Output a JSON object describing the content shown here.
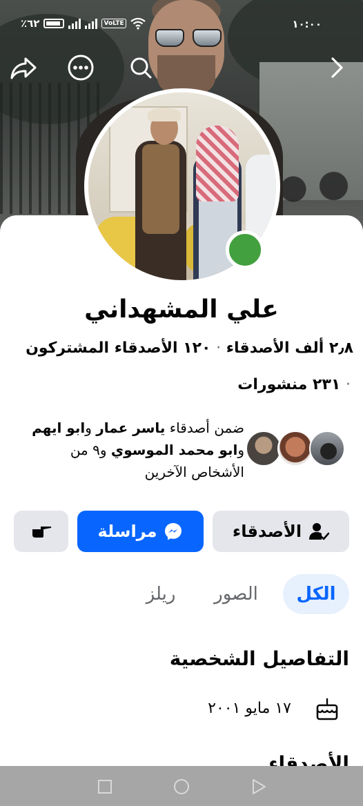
{
  "status_bar": {
    "time": "١٠:٠٠",
    "battery": "٪٦٢",
    "volte": "VoLTE"
  },
  "top_nav": {
    "icons": [
      "share-icon",
      "more-icon",
      "search-icon",
      "chevron-right-icon"
    ]
  },
  "profile": {
    "name": "علي المشهداني",
    "friends_count": "٢٫٨ ألف الأصدقاء",
    "mutual_friends": "١٢٠ الأصدقاء المشتركون",
    "posts": "٢٣١ منشورات",
    "separator": "·",
    "online": true
  },
  "mutual": {
    "prefix": "ضمن أصدقاء ",
    "name1": "ياسر عمار",
    "and1": " و",
    "name2": "ابو ايهم",
    "and2": " و",
    "name3": "ابو محمد الموسوي",
    "suffix": " و٩ من الأشخاص الآخرين"
  },
  "actions": {
    "friends_label": "الأصدقاء",
    "message_label": "مراسلة",
    "more_icon": "poke-icon"
  },
  "tabs": {
    "all": "الكل",
    "photos": "الصور",
    "reels": "ريلز",
    "selected": "all"
  },
  "details": {
    "title": "التفاصيل الشخصية",
    "birthday": "١٧ مايو ٢٠٠١",
    "birthday_icon": "birthday-cake-icon"
  },
  "next_section": {
    "title_partial": "الأصدقاء"
  },
  "colors": {
    "accent": "#0866ff",
    "online": "#42a03e",
    "secondary_button": "#e4e6eb",
    "tab_selected_bg": "#e7f0fd"
  }
}
